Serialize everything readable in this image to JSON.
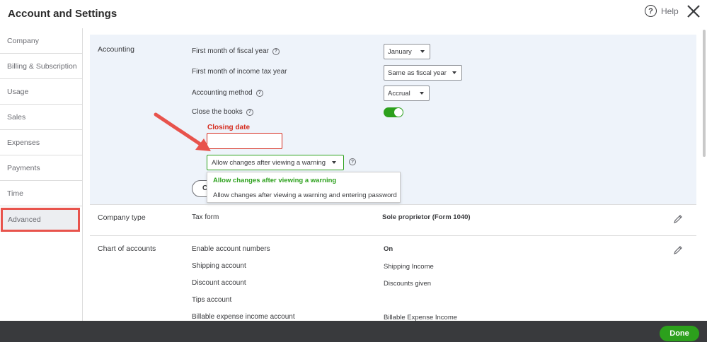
{
  "header": {
    "title": "Account and Settings",
    "help_label": "Help"
  },
  "sidebar": {
    "items": [
      {
        "label": "Company"
      },
      {
        "label": "Billing & Subscription"
      },
      {
        "label": "Usage"
      },
      {
        "label": "Sales"
      },
      {
        "label": "Expenses"
      },
      {
        "label": "Payments"
      },
      {
        "label": "Time"
      },
      {
        "label": "Advanced",
        "active": true
      }
    ]
  },
  "accounting": {
    "section_label": "Accounting",
    "fiscal_year_label": "First month of fiscal year",
    "fiscal_year_value": "January",
    "income_tax_label": "First month of income tax year",
    "income_tax_value": "Same as fiscal year",
    "method_label": "Accounting method",
    "method_value": "Accrual",
    "close_books_label": "Close the books",
    "close_books_enabled": true,
    "closing_date_label": "Closing date",
    "closing_date_value": "",
    "warning_select_value": "Allow changes after viewing a warning",
    "dropdown_options": [
      "Allow changes after viewing a warning",
      "Allow changes after viewing a warning and entering password"
    ],
    "cancel_button_label": "C"
  },
  "company_type": {
    "section_label": "Company type",
    "tax_form_label": "Tax form",
    "tax_form_value": "Sole proprietor (Form 1040)"
  },
  "chart_of_accounts": {
    "section_label": "Chart of accounts",
    "rows": [
      {
        "label": "Enable account numbers",
        "value": "On"
      },
      {
        "label": "Shipping account",
        "value": "Shipping Income"
      },
      {
        "label": "Discount account",
        "value": "Discounts given"
      },
      {
        "label": "Tips account",
        "value": ""
      },
      {
        "label": "Billable expense income account",
        "value": "Billable Expense Income"
      }
    ]
  },
  "footer": {
    "done_label": "Done"
  },
  "colors": {
    "accent": "#2ca01c",
    "error": "#d52b1e",
    "highlight": "#e8534c",
    "panel": "#eef3fa",
    "footer": "#393a3d"
  }
}
